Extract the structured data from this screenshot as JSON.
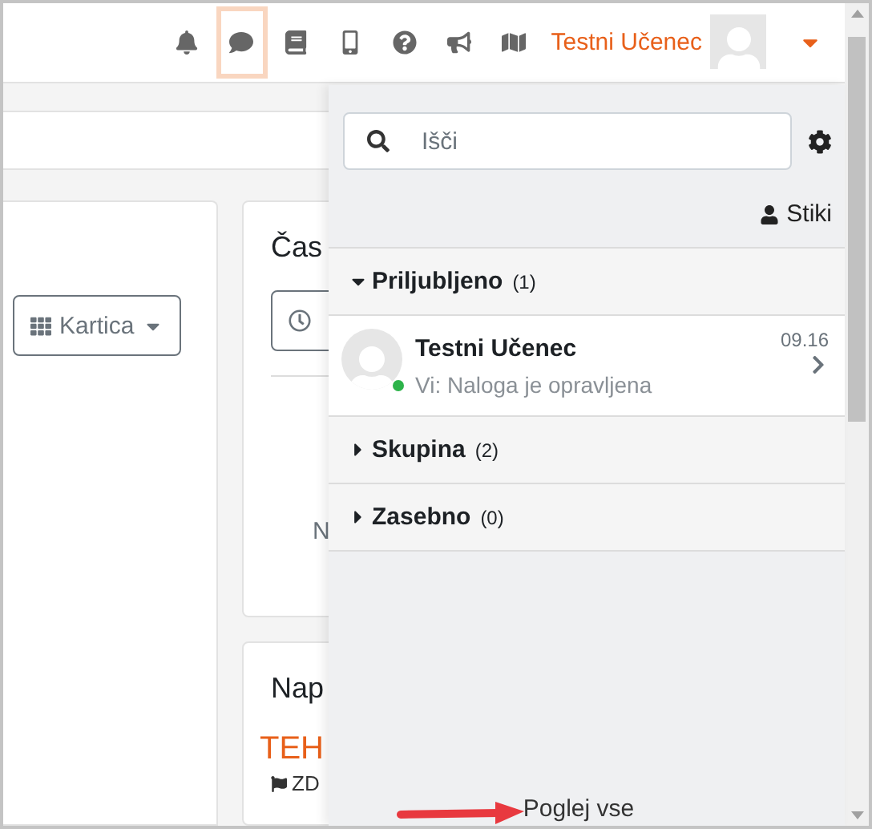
{
  "navbar": {
    "icons": [
      {
        "kind": "bell",
        "selected": false
      },
      {
        "kind": "chat",
        "selected": true
      },
      {
        "kind": "book",
        "selected": false
      },
      {
        "kind": "phone",
        "selected": false
      },
      {
        "kind": "help",
        "selected": false
      },
      {
        "kind": "megaphone",
        "selected": false
      },
      {
        "kind": "map",
        "selected": false
      }
    ],
    "user": {
      "name": "Testni Učenec"
    }
  },
  "page": {
    "view_button": "Kartica",
    "timeline_card": {
      "title": "Čas",
      "text": "N"
    },
    "news_card": {
      "title": "Nap",
      "headline": "TEH",
      "item": "ZD"
    }
  },
  "drawer": {
    "search": {
      "placeholder": "Išči"
    },
    "contacts_link": "Stiki",
    "sections": [
      {
        "title": "Priljubljeno",
        "count": "(1)",
        "expanded": true,
        "conversations": [
          {
            "name": "Testni Učenec",
            "time": "09.16",
            "preview": "Vi: Naloga je opravljena",
            "online": true
          }
        ]
      },
      {
        "title": "Skupina",
        "count": "(2)",
        "expanded": false
      },
      {
        "title": "Zasebno",
        "count": "(0)",
        "expanded": false
      }
    ],
    "footer_link": "Poglej vse"
  }
}
